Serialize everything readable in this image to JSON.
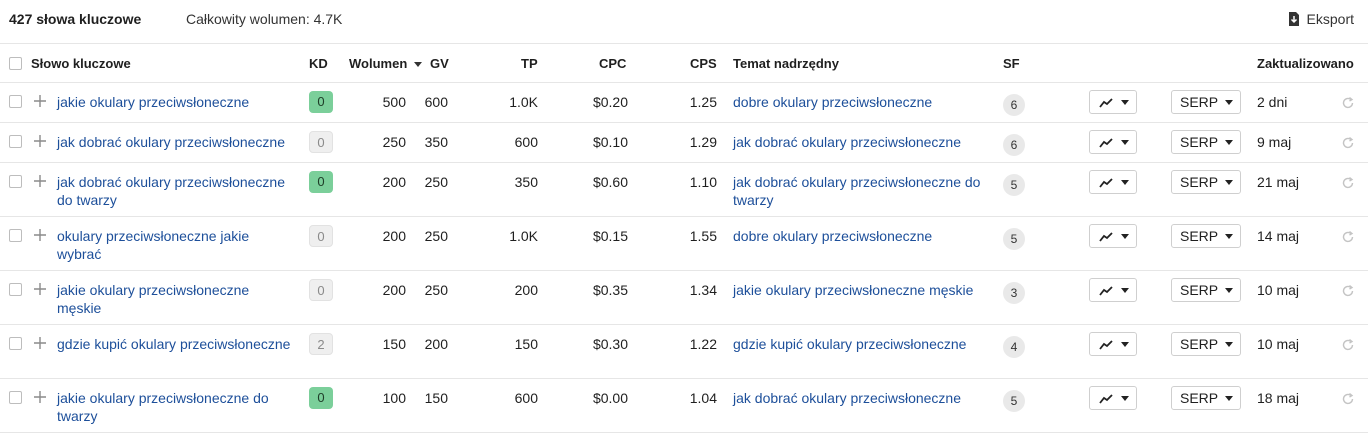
{
  "toolbar": {
    "keyword_count": "427 słowa kluczowe",
    "total_volume": "Całkowity wolumen: 4.7K",
    "export_label": "Eksport"
  },
  "columns": {
    "keyword": "Słowo kluczowe",
    "kd": "KD",
    "volume": "Wolumen",
    "gv": "GV",
    "tp": "TP",
    "cpc": "CPC",
    "cps": "CPS",
    "parent_topic": "Temat nadrzędny",
    "sf": "SF",
    "updated": "Zaktualizowano"
  },
  "rows": [
    {
      "keyword": "jakie okulary przeciwsłoneczne",
      "kd": "0",
      "kd_color": "green",
      "volume": "500",
      "gv": "600",
      "tp": "1.0K",
      "cpc": "$0.20",
      "cps": "1.25",
      "parent": "dobre okulary przeciwsłoneczne",
      "sf": "6",
      "serp": "SERP",
      "updated": "2 dni"
    },
    {
      "keyword": "jak dobrać okulary przeciwsłoneczne",
      "kd": "0",
      "kd_color": "gray",
      "volume": "250",
      "gv": "350",
      "tp": "600",
      "cpc": "$0.10",
      "cps": "1.29",
      "parent": "jak dobrać okulary przeciwsłoneczne",
      "sf": "6",
      "serp": "SERP",
      "updated": "9 maj"
    },
    {
      "keyword": "jak dobrać okulary przeciwsłoneczne do twarzy",
      "kd": "0",
      "kd_color": "green",
      "volume": "200",
      "gv": "250",
      "tp": "350",
      "cpc": "$0.60",
      "cps": "1.10",
      "parent": "jak dobrać okulary przeciwsłoneczne do twarzy",
      "sf": "5",
      "serp": "SERP",
      "updated": "21 maj"
    },
    {
      "keyword": "okulary przeciwsłoneczne jakie wybrać",
      "kd": "0",
      "kd_color": "gray",
      "volume": "200",
      "gv": "250",
      "tp": "1.0K",
      "cpc": "$0.15",
      "cps": "1.55",
      "parent": "dobre okulary przeciwsłoneczne",
      "sf": "5",
      "serp": "SERP",
      "updated": "14 maj"
    },
    {
      "keyword": "jakie okulary przeciwsłoneczne męskie",
      "kd": "0",
      "kd_color": "gray",
      "volume": "200",
      "gv": "250",
      "tp": "200",
      "cpc": "$0.35",
      "cps": "1.34",
      "parent": "jakie okulary przeciwsłoneczne męskie",
      "sf": "3",
      "serp": "SERP",
      "updated": "10 maj"
    },
    {
      "keyword": "gdzie kupić okulary przeciwsłoneczne",
      "kd": "2",
      "kd_color": "gray",
      "volume": "150",
      "gv": "200",
      "tp": "150",
      "cpc": "$0.30",
      "cps": "1.22",
      "parent": "gdzie kupić okulary przeciwsłoneczne",
      "sf": "4",
      "serp": "SERP",
      "updated": "10 maj"
    },
    {
      "keyword": "jakie okulary przeciwsłoneczne do twarzy",
      "kd": "0",
      "kd_color": "green",
      "volume": "100",
      "gv": "150",
      "tp": "600",
      "cpc": "$0.00",
      "cps": "1.04",
      "parent": "jak dobrać okulary przeciwsłoneczne",
      "sf": "5",
      "serp": "SERP",
      "updated": "18 maj"
    }
  ],
  "icons": {
    "export": "download-icon",
    "row_add": "plus-icon",
    "trend": "trend-chart-icon",
    "dropdown": "caret-down-icon",
    "refresh": "refresh-icon",
    "sort": "sort-down-icon"
  },
  "colors": {
    "link": "#1d4f9a",
    "kd_green": "#7bcf9a",
    "kd_gray": "#efefef"
  }
}
